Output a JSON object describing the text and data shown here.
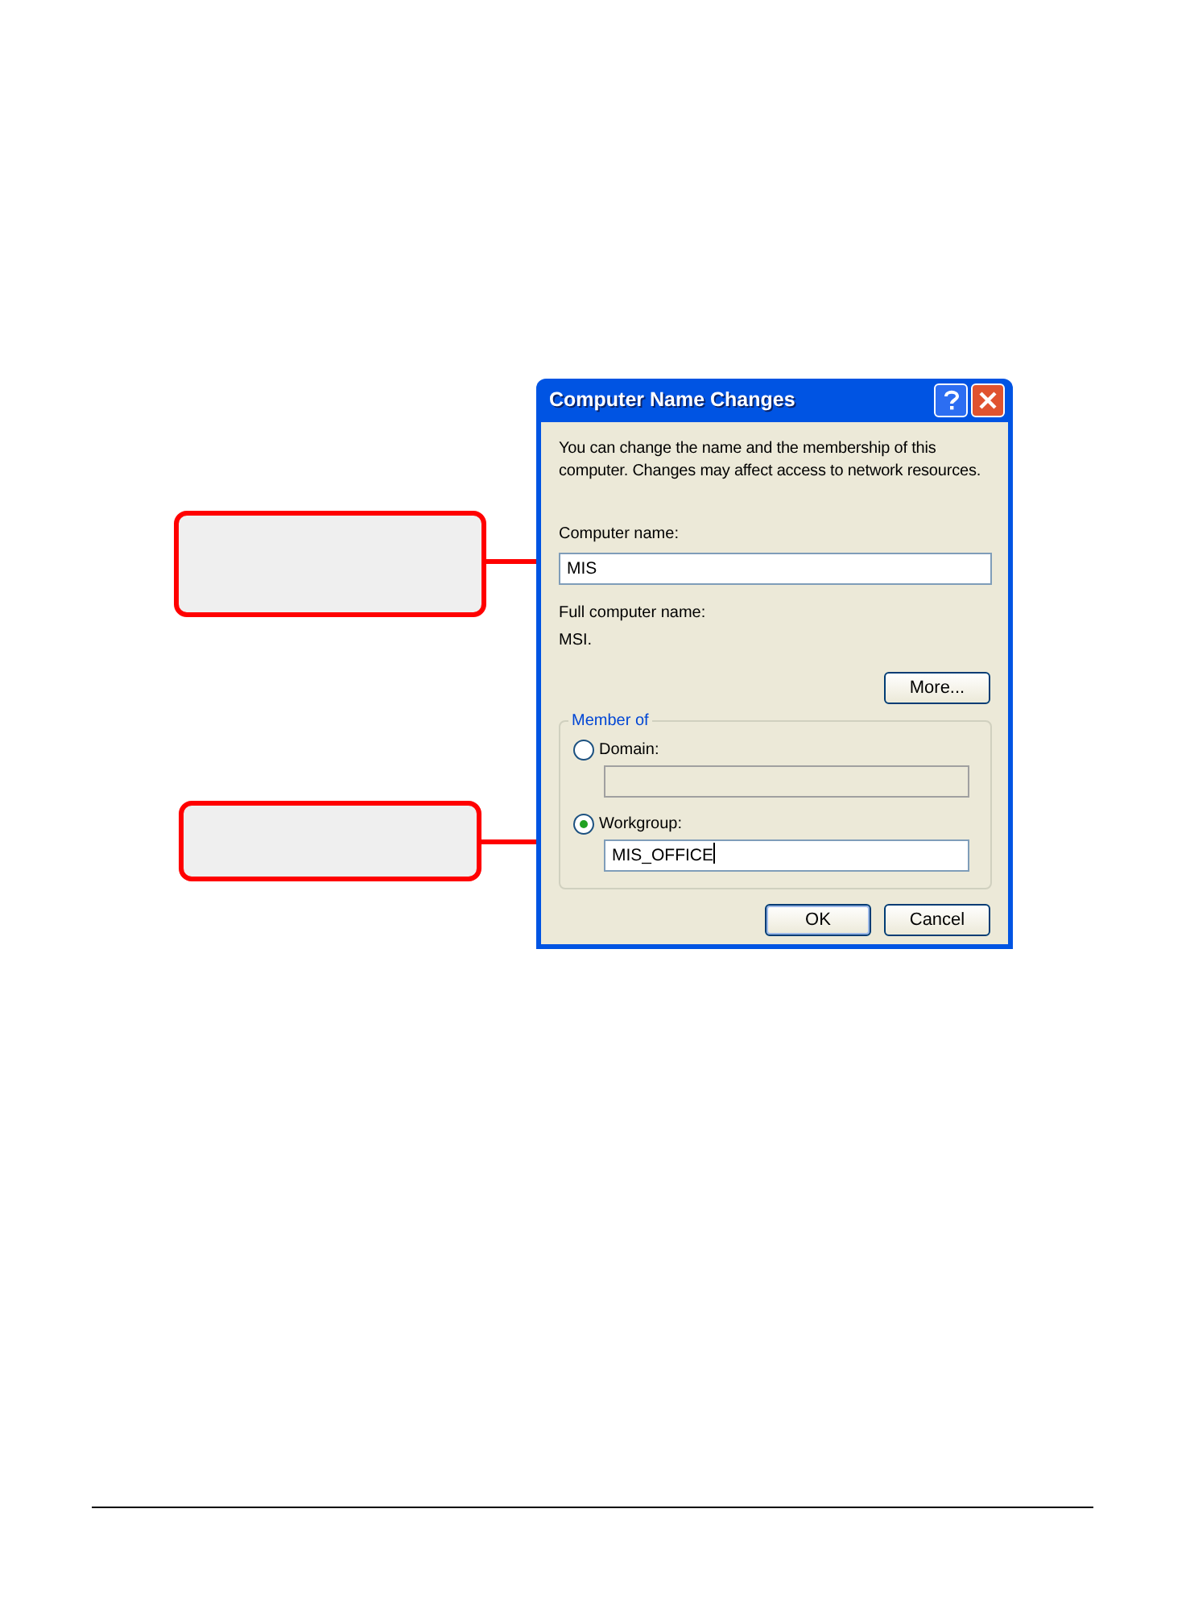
{
  "dialog": {
    "title": "Computer Name Changes",
    "intro": "You can change the name and the membership of this computer. Changes may affect access to network resources.",
    "computer_name": {
      "label": "Computer name:",
      "value": "MIS"
    },
    "full_name": {
      "label": "Full computer name:",
      "value": "MSI."
    },
    "more_button": "More...",
    "member_of": {
      "legend": "Member of",
      "options": [
        {
          "label": "Domain:",
          "selected": false,
          "value_disabled": true
        },
        {
          "label": "Workgroup:",
          "selected": true,
          "value": "MIS_OFFICE",
          "value_disabled": false
        }
      ]
    },
    "buttons": [
      "OK",
      "Cancel"
    ]
  }
}
